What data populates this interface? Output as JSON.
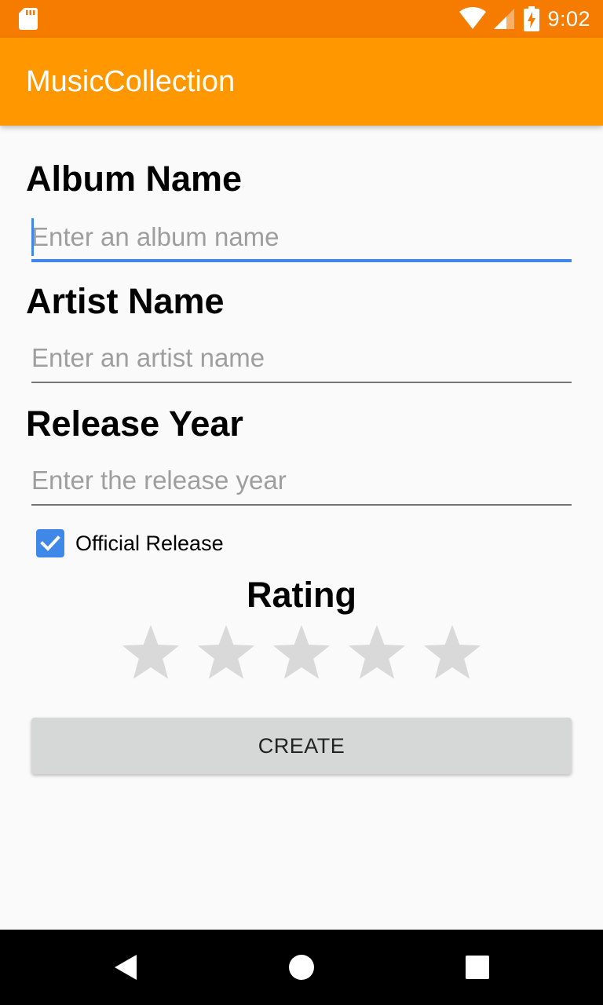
{
  "status_bar": {
    "time": "9:02",
    "icons": [
      "sd-card-icon",
      "wifi-icon",
      "cell-signal-icon",
      "battery-charging-icon"
    ]
  },
  "app_bar": {
    "title": "MusicCollection"
  },
  "form": {
    "album": {
      "label": "Album Name",
      "value": "",
      "placeholder": "Enter an album name",
      "focused": true
    },
    "artist": {
      "label": "Artist Name",
      "value": "",
      "placeholder": "Enter an artist name"
    },
    "year": {
      "label": "Release Year",
      "value": "",
      "placeholder": "Enter the release year"
    },
    "official_release": {
      "label": "Official Release",
      "checked": true
    },
    "rating": {
      "label": "Rating",
      "value": 0,
      "max": 5
    },
    "create_label": "CREATE"
  },
  "nav_bar": {
    "buttons": [
      "back-icon",
      "home-icon",
      "recents-icon"
    ]
  },
  "colors": {
    "status_bar": "#f57c00",
    "app_bar": "#ff9800",
    "accent": "#3f88e8",
    "star_empty": "#d9d9d9",
    "button_bg": "#d6d7d7"
  }
}
